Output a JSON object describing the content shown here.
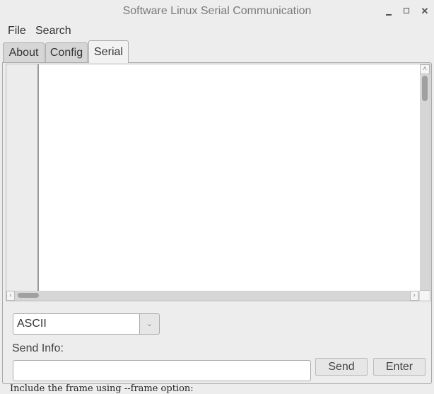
{
  "window": {
    "title": "Software Linux Serial Communication",
    "controls": {
      "minimize": "",
      "maximize": "",
      "close": "✕"
    }
  },
  "menubar": {
    "items": [
      "File",
      "Search"
    ]
  },
  "tabs": [
    {
      "label": "About",
      "active": false
    },
    {
      "label": "Config",
      "active": false
    },
    {
      "label": "Serial",
      "active": true
    }
  ],
  "serial": {
    "output_text": "",
    "encoding": {
      "selected": "ASCII",
      "dropdown_icon": "⌄"
    },
    "send_label": "Send Info:",
    "send_value": "",
    "send_button": "Send",
    "enter_button": "Enter"
  },
  "scroll_icons": {
    "up": "˄",
    "down": "˅",
    "left": "‹",
    "right": "›"
  },
  "background_text": "Include the frame using --frame option:"
}
